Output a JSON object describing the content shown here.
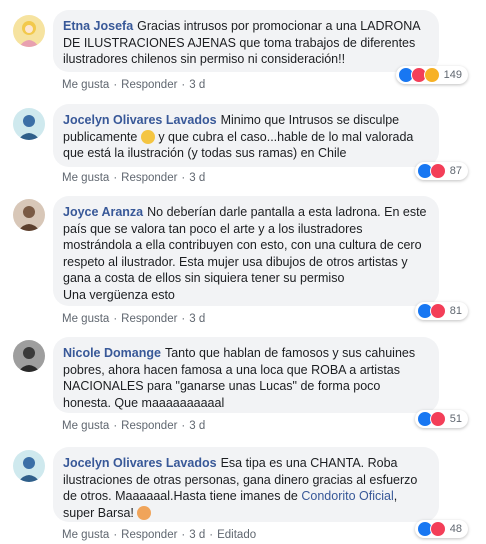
{
  "comments": [
    {
      "author": "Etna Josefa",
      "text": "Gracias intrusos por promocionar a una LADRONA DE ILUSTRACIONES AJENAS que toma trabajos de diferentes ilustradores chilenos sin permiso ni consideración!!",
      "like": "Me gusta",
      "reply": "Responder",
      "time": "3 d",
      "reactions": [
        "like-icon",
        "love-icon",
        "wow-icon"
      ],
      "count": "149"
    },
    {
      "author": "Jocelyn Olivares Lavados",
      "text_a": "Minimo que Intrusos se disculpe publicamente",
      "text_b": "y que cubra el caso...hable de lo mal valorada que está la ilustración (y todas sus ramas) en Chile",
      "like": "Me gusta",
      "reply": "Responder",
      "time": "3 d",
      "reactions": [
        "like-icon",
        "love-icon"
      ],
      "count": "87"
    },
    {
      "author": "Joyce Aranza",
      "text": "No deberían darle pantalla a esta ladrona. En este país que se valora tan poco el arte y a los ilustradores mostrándola a ella contribuyen con esto, con una cultura de cero respeto al ilustrador. Esta mujer usa dibujos de otros artistas y gana a costa de ellos sin siquiera tener su permiso",
      "text2": "Una vergüenza esto",
      "like": "Me gusta",
      "reply": "Responder",
      "time": "3 d",
      "reactions": [
        "like-icon",
        "love-icon"
      ],
      "count": "81"
    },
    {
      "author": "Nicole Domange",
      "text": "Tanto que hablan de famosos y sus cahuines pobres, ahora hacen famosa a una loca que ROBA a artistas NACIONALES para \"ganarse unas Lucas\" de forma poco honesta. Que maaaaaaaaaal",
      "like": "Me gusta",
      "reply": "Responder",
      "time": "3 d",
      "reactions": [
        "like-icon",
        "love-icon"
      ],
      "count": "51"
    },
    {
      "author": "Jocelyn Olivares Lavados",
      "text_a": "Esa tipa es una CHANTA. Roba ilustraciones de otras personas, gana dinero gracias al esfuerzo de otros. Maaaaaal.Hasta tiene imanes de",
      "link": "Condorito Oficial",
      "text_b": ", super Barsa!",
      "like": "Me gusta",
      "reply": "Responder",
      "time": "3 d",
      "edited": "Editado",
      "reactions": [
        "like-icon",
        "love-icon"
      ],
      "count": "48"
    }
  ],
  "colors": {
    "like": "#1877f2",
    "love": "#f33e58",
    "wow": "#f7b125",
    "name": "#385898"
  }
}
